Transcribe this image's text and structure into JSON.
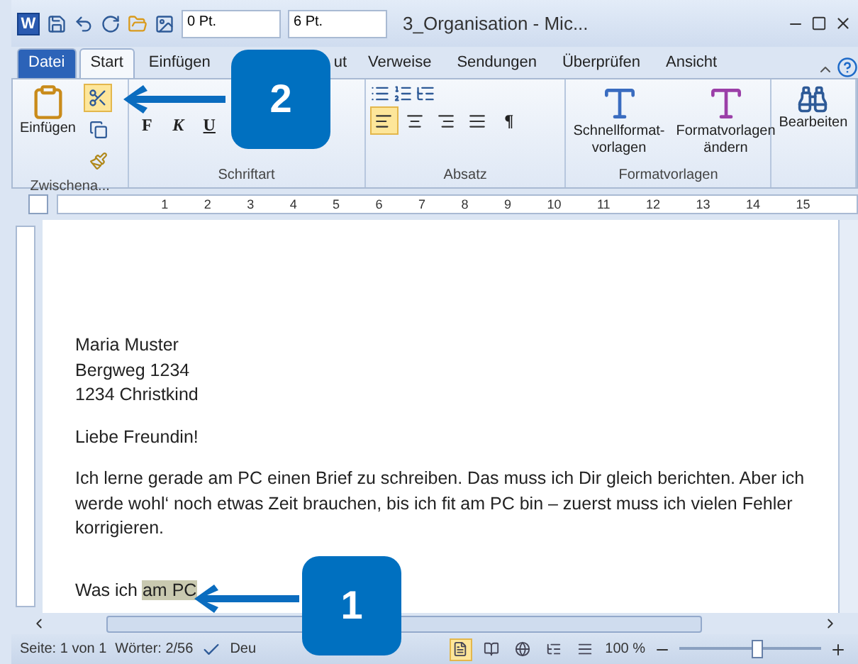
{
  "title_bar": {
    "title": "3_Organisation - Mic...",
    "quick_access": {
      "spacing_before": "0 Pt.",
      "spacing_after": "6 Pt."
    },
    "app_letter": "W"
  },
  "tabs": [
    {
      "label": "Datei",
      "kind": "file",
      "selected": false
    },
    {
      "label": "Start",
      "kind": "tab",
      "selected": true
    },
    {
      "label": "Einfügen",
      "kind": "tab",
      "selected": false
    },
    {
      "label": "ut",
      "kind": "tab",
      "selected": false
    },
    {
      "label": "Verweise",
      "kind": "tab",
      "selected": false
    },
    {
      "label": "Sendungen",
      "kind": "tab",
      "selected": false
    },
    {
      "label": "Überprüfen",
      "kind": "tab",
      "selected": false
    },
    {
      "label": "Ansicht",
      "kind": "tab",
      "selected": false
    }
  ],
  "ribbon": {
    "clipboard": {
      "paste_label": "Einfügen",
      "group_label": "Zwischena...",
      "cut_active": true
    },
    "font": {
      "bold": "F",
      "italic": "K",
      "underline": "U",
      "group_label": "Schriftart"
    },
    "paragraph": {
      "group_label": "Absatz",
      "alignments": [
        {
          "selected": true
        },
        {
          "selected": false
        },
        {
          "selected": false
        },
        {
          "selected": false
        }
      ],
      "pilcrow": "¶"
    },
    "styles": {
      "quick": "Schnellformat-",
      "quick2": "vorlagen",
      "change": "Formatvorlagen",
      "change2": "ändern",
      "group_label": "Formatvorlagen"
    },
    "editing": {
      "label": "Bearbeiten"
    }
  },
  "ruler": {
    "numbers": [
      "1",
      "2",
      "3",
      "4",
      "5",
      "6",
      "7",
      "8",
      "9",
      "10",
      "11",
      "12",
      "13",
      "14",
      "15"
    ]
  },
  "document": {
    "address": [
      "Maria Muster",
      "Bergweg 1234",
      "1234 Christkind"
    ],
    "greeting": "Liebe Freundin!",
    "paragraph": "Ich lerne gerade am PC einen Brief zu schreiben. Das muss ich Dir gleich berichten. Aber ich werde wohl‘ noch etwas Zeit brauchen, bis ich fit am PC bin – zuerst muss ich vielen Fehler korrigieren.",
    "last_line": {
      "text": "Was ich",
      "highlighted": "am PC"
    }
  },
  "status_bar": {
    "page": "Seite: 1 von 1",
    "words": "Wörter: 2/56",
    "language": "Deu",
    "views": [
      {
        "selected": true
      },
      {
        "selected": false
      },
      {
        "selected": false
      },
      {
        "selected": false
      },
      {
        "selected": false
      }
    ],
    "zoom": "100 %",
    "zoom_slider": {
      "level": 0.55
    }
  },
  "callouts": [
    {
      "number": "2"
    },
    {
      "number": "1"
    }
  ]
}
